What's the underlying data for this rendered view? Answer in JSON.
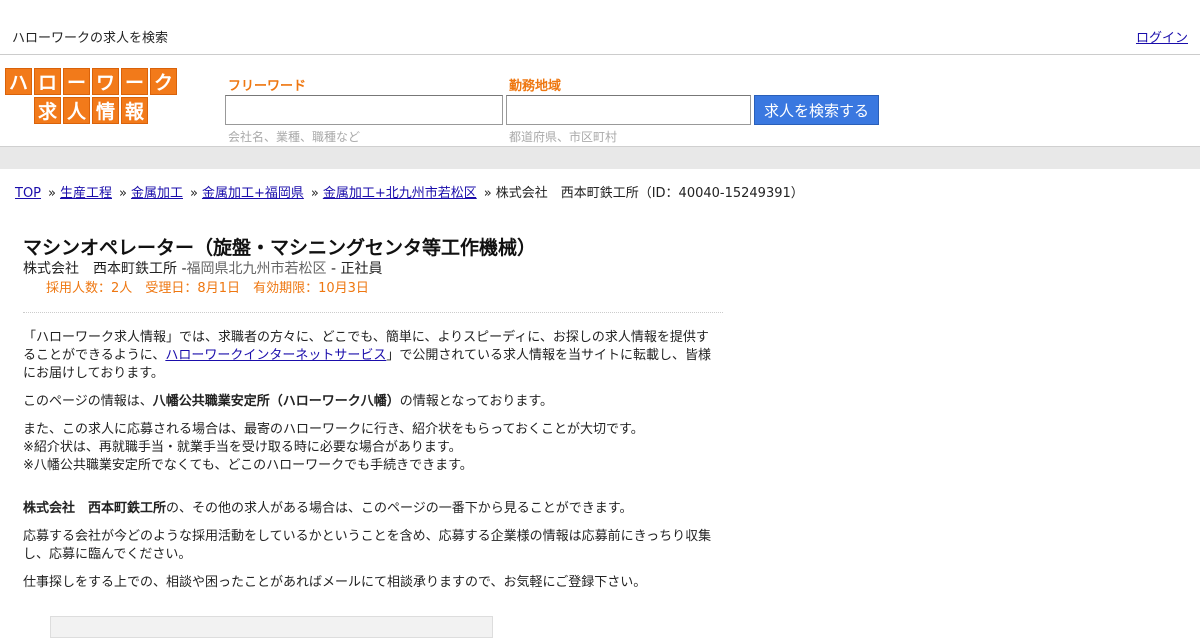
{
  "header": {
    "site_caption": "ハローワークの求人を検索",
    "login": "ログイン"
  },
  "logo": {
    "row1": [
      "ハ",
      "ロ",
      "ー",
      "ワ",
      "ー",
      "ク"
    ],
    "row2": [
      "求",
      "人",
      "情",
      "報"
    ],
    "color": "#f27a1a"
  },
  "search": {
    "freeword_label": "フリーワード",
    "freeword_value": "",
    "freeword_hint": "会社名、業種、職種など",
    "area_label": "勤務地域",
    "area_value": "",
    "area_hint": "都道府県、市区町村",
    "button": "求人を検索する",
    "button_color": "#3a78e0"
  },
  "breadcrumb": {
    "items": [
      "TOP",
      "生産工程",
      "金属加工",
      "金属加工+福岡県",
      "金属加工+北九州市若松区"
    ],
    "separator": "»",
    "current": "株式会社　西本町鉄工所（ID：40040-15249391）"
  },
  "job": {
    "title": "マシンオペレーター（旋盤・マシニングセンタ等工作機械）",
    "company": "株式会社　西本町鉄工所",
    "location": "福岡県北九州市若松区",
    "employment": "正社員",
    "hires": "採用人数：2人",
    "received": "受理日：8月1日",
    "expiry": "有効期限：10月3日"
  },
  "content": {
    "intro_a": "「ハローワーク求人情報」では、求職者の方々に、どこでも、簡単に、よりスピーディに、お探しの求人情報を提供することができるように、",
    "intro_link": "ハローワークインターネットサービス",
    "intro_b": "」で公開されている求人情報を当サイトに転載し、皆様にお届けしております。",
    "source_a": "このページの情報は、",
    "source_office": "八幡公共職業安定所（ハローワーク八幡）",
    "source_b": "の情報となっております。",
    "note1": "また、この求人に応募される場合は、最寄のハローワークに行き、紹介状をもらっておくことが大切です。",
    "note2": "※紹介状は、再就職手当・就業手当を受け取る時に必要な場合があります。",
    "note3": "※八幡公共職業安定所でなくても、どこのハローワークでも手続きできます。",
    "other_company": "株式会社　西本町鉄工所",
    "other_text": "の、その他の求人がある場合は、このページの一番下から見ることができます。",
    "advice": "応募する会社が今どのような採用活動をしているかということを含め、応募する企業様の情報は応募前にきっちり収集し、応募に臨んでください。",
    "contact": "仕事探しをする上での、相談や困ったことがあればメールにて相談承りますので、お気軽にご登録下さい。"
  },
  "colors": {
    "accent_orange": "#ee7711",
    "link": "#1a0dab"
  }
}
